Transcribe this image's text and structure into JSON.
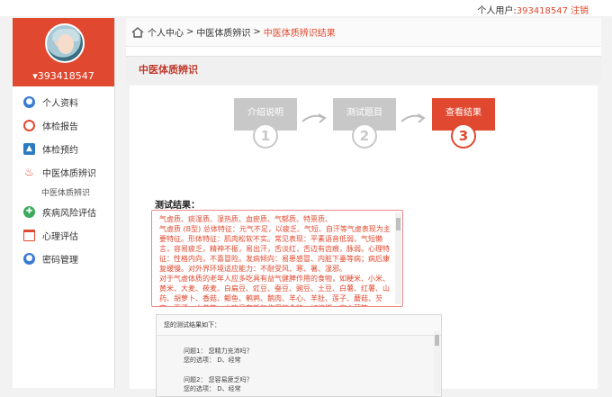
{
  "topbar": {
    "user_prefix": "个人用户:",
    "user_id": "393418547",
    "logout": "注销"
  },
  "sidebar": {
    "username": "393418547",
    "items": [
      {
        "label": "个人资料",
        "icon": "user-icon",
        "color": "#3a7bd5"
      },
      {
        "label": "体检报告",
        "icon": "stethoscope-icon",
        "color": "#e0492f"
      },
      {
        "label": "体检预约",
        "icon": "image-icon",
        "color": "#2a7bbf"
      },
      {
        "label": "中医体质辨识",
        "icon": "flame-icon",
        "color": "#e0492f"
      },
      {
        "label": "中医体质辨识",
        "icon": "",
        "color": ""
      },
      {
        "label": "疾病风险评估",
        "icon": "globe-icon",
        "color": "#3aaa5b"
      },
      {
        "label": "心理评估",
        "icon": "calendar-icon",
        "color": "#e0492f"
      },
      {
        "label": "密码管理",
        "icon": "user-lock-icon",
        "color": "#3a7bd5"
      }
    ]
  },
  "breadcrumb": {
    "home": "个人中心",
    "sep": ">",
    "mid": "中医体质辨识",
    "current": "中医体质辨识结果"
  },
  "panel": {
    "title": "中医体质辨识"
  },
  "steps": [
    {
      "label": "介绍说明",
      "number": "1"
    },
    {
      "label": "测试题目",
      "number": "2"
    },
    {
      "label": "查看结果",
      "number": "3"
    }
  ],
  "result": {
    "label": "测试结果：",
    "lines": [
      "气虚质、痰湿质、湿热质、血瘀质、气郁质、特禀质、",
      "气虚质 (B型) 总体特征：元气不足，以疲乏、气短、自汗等气虚表现为主要特征。形体特征：肌肉松软不实。常见表现：平素语音低弱，气短懒言，容易疲乏，精神不振，易出汗，舌淡红，舌边有齿痕，脉弱。心理特征：性格内向，不喜冒险。发病倾向：易患感冒、内脏下垂等病；病后康复缓慢。对外界环境适应能力：不耐受风、寒、暑、湿邪。",
      "对于气虚体质的老年人应多吃具有益气健脾作用的食物，如粳米、小米、黄米、大麦、莜麦、白扁豆、豇豆、蚕豆、豌豆、土豆、白薯、红薯、山药、胡萝卜、香菇、鲫鱼、鹌鹑、鹅肉、羊心、羊肚、莲子、蘑菇、芡实、栗子、人参等。少吃具有耗气作用的食物，如槟榔、空心菜等。"
    ]
  },
  "questions": {
    "head": "您的测试结果如下：",
    "items": [
      {
        "q": "问题1： 您精力充沛吗？",
        "a": "您的选项： D、经常"
      },
      {
        "q": "问题2： 您容易疲乏吗？",
        "a": "您的选项： D、经常"
      }
    ]
  },
  "colors": {
    "accent": "#e0492f",
    "step_inactive": "#c8c8c8"
  }
}
